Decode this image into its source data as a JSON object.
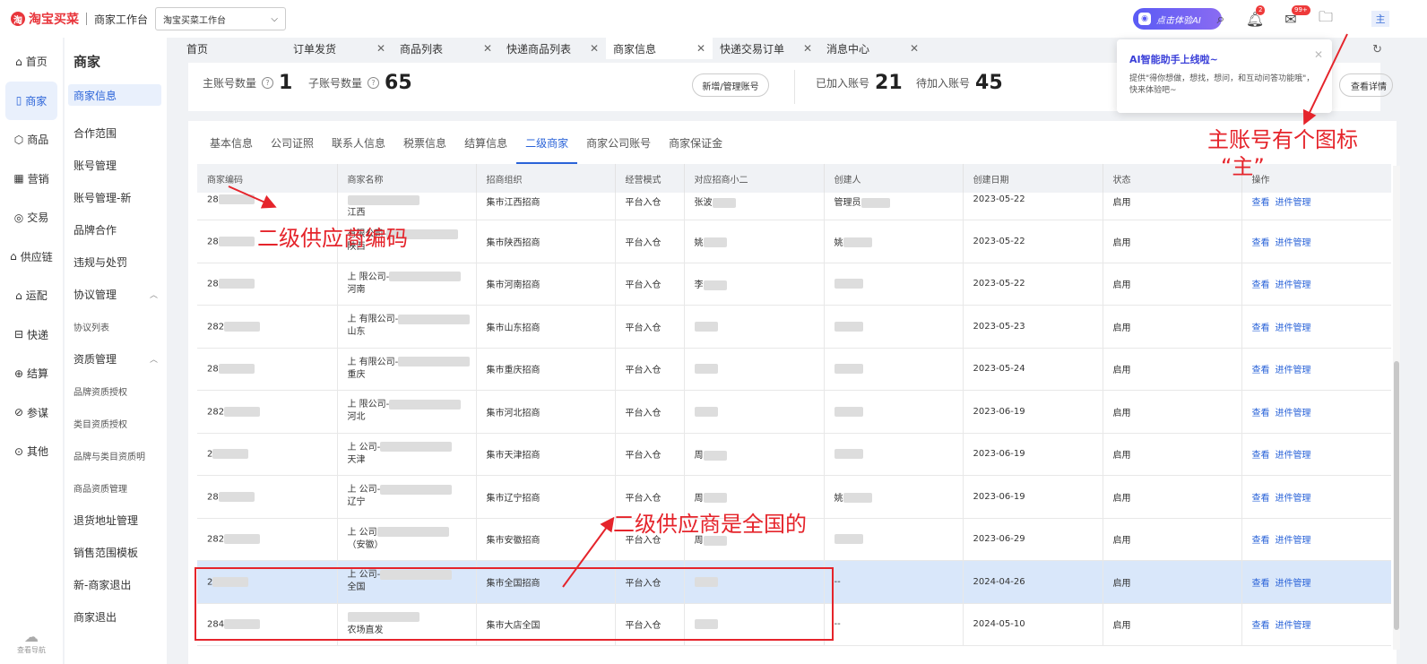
{
  "topbar": {
    "logo_text": "淘宝买菜",
    "workbench": "商家工作台",
    "workspace_select": "淘宝买菜工作台",
    "ai_button": "点击体验AI",
    "bell_badge": "2",
    "mail_badge": "99+",
    "avatar_text": "主"
  },
  "leftnav": [
    {
      "label": "首页",
      "icon": "home-icon"
    },
    {
      "label": "商家",
      "icon": "merchant-icon"
    },
    {
      "label": "商品",
      "icon": "cube-icon"
    },
    {
      "label": "营销",
      "icon": "calendar-icon"
    },
    {
      "label": "交易",
      "icon": "trade-icon"
    },
    {
      "label": "供应链",
      "icon": "supply-icon"
    },
    {
      "label": "运配",
      "icon": "delivery-icon"
    },
    {
      "label": "快递",
      "icon": "express-icon"
    },
    {
      "label": "结算",
      "icon": "settlement-icon"
    },
    {
      "label": "参谋",
      "icon": "compass-icon"
    },
    {
      "label": "其他",
      "icon": "other-icon"
    }
  ],
  "leftnav_footer": "查看导航",
  "subnav": {
    "title": "商家",
    "items": [
      "商家信息",
      "合作范围",
      "账号管理",
      "账号管理-新",
      "品牌合作",
      "违规与处罚",
      "协议管理",
      "协议列表",
      "资质管理",
      "品牌资质授权",
      "类目资质授权",
      "品牌与类目资质明",
      "商品资质管理",
      "退货地址管理",
      "销售范围模板",
      "新-商家退出",
      "商家退出"
    ]
  },
  "tabs": [
    {
      "label": "首页"
    },
    {
      "label": "订单发货"
    },
    {
      "label": "商品列表"
    },
    {
      "label": "快递商品列表"
    },
    {
      "label": "商家信息"
    },
    {
      "label": "快递交易订单"
    },
    {
      "label": "消息中心"
    }
  ],
  "summary": {
    "main_label": "主账号数量",
    "main_count": "1",
    "sub_label": "子账号数量",
    "sub_count": "65",
    "manage_btn": "新增/管理账号",
    "joined_label": "已加入账号",
    "joined_count": "21",
    "pending_label": "待加入账号",
    "pending_count": "45",
    "detail_btn": "查看详情"
  },
  "popup": {
    "title": "AI智能助手上线啦~",
    "desc": "提供\"得你想做，想找，想问，和互动问答功能哦\"，快来体验吧~"
  },
  "section_tabs": [
    "基本信息",
    "公司证照",
    "联系人信息",
    "税票信息",
    "结算信息",
    "二级商家",
    "商家公司账号",
    "商家保证金"
  ],
  "table": {
    "headers": [
      "商家编码",
      "商家名称",
      "招商组织",
      "经营模式",
      "对应招商小二",
      "创建人",
      "创建日期",
      "状态",
      "操作"
    ],
    "rows": [
      {
        "code": "28",
        "name1": "",
        "name2": "江西",
        "org": "集市江西招商",
        "mode": "平台入仓",
        "staff": "张波",
        "creator": "管理员",
        "date": "2023-05-22",
        "status": "启用"
      },
      {
        "code": "28",
        "name1": "有限公司-",
        "name2": "陕西",
        "org": "集市陕西招商",
        "mode": "平台入仓",
        "staff": "姚",
        "creator": "姚",
        "date": "2023-05-22",
        "status": "启用"
      },
      {
        "code": "28",
        "name1": "上 限公司-",
        "name2": "河南",
        "org": "集市河南招商",
        "mode": "平台入仓",
        "staff": "李",
        "creator": "",
        "date": "2023-05-22",
        "status": "启用"
      },
      {
        "code": "282",
        "name1": "上 有限公司-",
        "name2": "山东",
        "org": "集市山东招商",
        "mode": "平台入仓",
        "staff": "",
        "creator": "",
        "date": "2023-05-23",
        "status": "启用"
      },
      {
        "code": "28",
        "name1": "上 有限公司-",
        "name2": "重庆",
        "org": "集市重庆招商",
        "mode": "平台入仓",
        "staff": "",
        "creator": "",
        "date": "2023-05-24",
        "status": "启用"
      },
      {
        "code": "282",
        "name1": "上 限公司-",
        "name2": "河北",
        "org": "集市河北招商",
        "mode": "平台入仓",
        "staff": "",
        "creator": "",
        "date": "2023-06-19",
        "status": "启用"
      },
      {
        "code": "2",
        "name1": "上 公司-",
        "name2": "天津",
        "org": "集市天津招商",
        "mode": "平台入仓",
        "staff": "周",
        "creator": "",
        "date": "2023-06-19",
        "status": "启用"
      },
      {
        "code": "28",
        "name1": "上 公司-",
        "name2": "辽宁",
        "org": "集市辽宁招商",
        "mode": "平台入仓",
        "staff": "周",
        "creator": "姚",
        "date": "2023-06-19",
        "status": "启用"
      },
      {
        "code": "282",
        "name1": "上 公司",
        "name2": "（安徽）",
        "org": "集市安徽招商",
        "mode": "平台入仓",
        "staff": "周",
        "creator": "",
        "date": "2023-06-29",
        "status": "启用"
      },
      {
        "code": "2",
        "name1": "上 公司-",
        "name2": "全国",
        "org": "集市全国招商",
        "mode": "平台入仓",
        "staff": "",
        "creator": "--",
        "date": "2024-04-26",
        "status": "启用",
        "hl": true
      },
      {
        "code": "284",
        "name1": "",
        "name2": "农场直发",
        "org": "集市大店全国",
        "mode": "平台入仓",
        "staff": "",
        "creator": "--",
        "date": "2024-05-10",
        "status": "启用"
      }
    ],
    "op_view": "查看",
    "op_manage": "进件管理"
  },
  "annotations": {
    "a1": "二级供应商编码",
    "a2": "二级供应商是全国的",
    "a3": "主账号有个图标",
    "a3b": "“主”"
  },
  "colors": {
    "accent": "#2a63d8",
    "annotation": "#e5242b",
    "brand": "#e8353b"
  }
}
